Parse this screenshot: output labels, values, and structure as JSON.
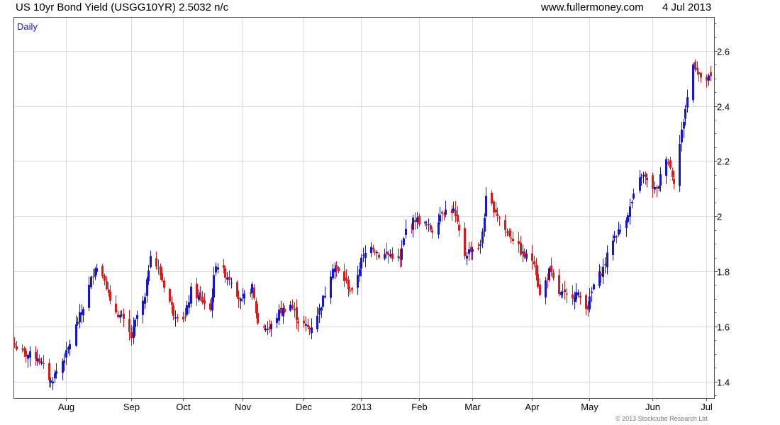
{
  "header": {
    "title": "US 10yr Bond Yield (USGG10YR) 2.5032 n/c",
    "site": "www.fullermoney.com",
    "date": "4 Jul 2013"
  },
  "footer": {
    "copyright": "© 2013 Stockcube Research Ltd"
  },
  "colors": {
    "up": "#1515d8",
    "down": "#e01818",
    "grid": "#dcdcdc",
    "axis": "#555555",
    "period_label": "#1a1ab4"
  },
  "chart_data": {
    "type": "candlestick",
    "period_label": "Daily",
    "title": "US 10yr Bond Yield (USGG10YR)",
    "last_value": 2.5032,
    "ylim": [
      1.34,
      2.72
    ],
    "y_ticks": [
      1.4,
      1.6,
      1.8,
      2.0,
      2.2,
      2.4,
      2.6
    ],
    "y_tick_labels": [
      "1.4",
      "1.6",
      "1.8",
      "2",
      "2.2",
      "2.4",
      "2.6"
    ],
    "y_axis_position": "right",
    "grid": true,
    "x_range": [
      "2012-07-05",
      "2013-07-05"
    ],
    "x_ticks": [
      {
        "date": "2012-08-01",
        "label": "Aug"
      },
      {
        "date": "2012-09-04",
        "label": "Sep"
      },
      {
        "date": "2012-10-01",
        "label": "Oct"
      },
      {
        "date": "2012-11-01",
        "label": "Nov"
      },
      {
        "date": "2012-12-03",
        "label": "Dec"
      },
      {
        "date": "2013-01-02",
        "label": "2013"
      },
      {
        "date": "2013-02-01",
        "label": "Feb"
      },
      {
        "date": "2013-03-01",
        "label": "Mar"
      },
      {
        "date": "2013-04-01",
        "label": "Apr"
      },
      {
        "date": "2013-05-01",
        "label": "May"
      },
      {
        "date": "2013-06-03",
        "label": "Jun"
      },
      {
        "date": "2013-07-01",
        "label": "Jul"
      }
    ],
    "close_anchors": [
      [
        "2012-07-05",
        1.53
      ],
      [
        "2012-07-10",
        1.5
      ],
      [
        "2012-07-17",
        1.49
      ],
      [
        "2012-07-24",
        1.4
      ],
      [
        "2012-08-01",
        1.5
      ],
      [
        "2012-08-07",
        1.62
      ],
      [
        "2012-08-10",
        1.67
      ],
      [
        "2012-08-16",
        1.82
      ],
      [
        "2012-08-21",
        1.78
      ],
      [
        "2012-08-24",
        1.68
      ],
      [
        "2012-08-30",
        1.63
      ],
      [
        "2012-09-04",
        1.56
      ],
      [
        "2012-09-07",
        1.64
      ],
      [
        "2012-09-11",
        1.7
      ],
      [
        "2012-09-14",
        1.87
      ],
      [
        "2012-09-20",
        1.77
      ],
      [
        "2012-09-26",
        1.65
      ],
      [
        "2012-10-02",
        1.63
      ],
      [
        "2012-10-05",
        1.73
      ],
      [
        "2012-10-10",
        1.7
      ],
      [
        "2012-10-15",
        1.66
      ],
      [
        "2012-10-18",
        1.83
      ],
      [
        "2012-10-23",
        1.79
      ],
      [
        "2012-10-26",
        1.77
      ],
      [
        "2012-10-31",
        1.69
      ],
      [
        "2012-11-06",
        1.74
      ],
      [
        "2012-11-09",
        1.61
      ],
      [
        "2012-11-15",
        1.59
      ],
      [
        "2012-11-20",
        1.65
      ],
      [
        "2012-11-26",
        1.68
      ],
      [
        "2012-11-30",
        1.62
      ],
      [
        "2012-12-06",
        1.59
      ],
      [
        "2012-12-11",
        1.66
      ],
      [
        "2012-12-14",
        1.72
      ],
      [
        "2012-12-18",
        1.82
      ],
      [
        "2012-12-24",
        1.77
      ],
      [
        "2012-12-28",
        1.72
      ],
      [
        "2013-01-02",
        1.84
      ],
      [
        "2013-01-07",
        1.9
      ],
      [
        "2013-01-11",
        1.86
      ],
      [
        "2013-01-17",
        1.86
      ],
      [
        "2013-01-22",
        1.84
      ],
      [
        "2013-01-25",
        1.95
      ],
      [
        "2013-01-30",
        1.99
      ],
      [
        "2013-02-04",
        1.97
      ],
      [
        "2013-02-08",
        1.95
      ],
      [
        "2013-02-13",
        2.02
      ],
      [
        "2013-02-19",
        2.02
      ],
      [
        "2013-02-25",
        1.86
      ],
      [
        "2013-02-28",
        1.88
      ],
      [
        "2013-03-05",
        1.89
      ],
      [
        "2013-03-08",
        2.06
      ],
      [
        "2013-03-13",
        2.02
      ],
      [
        "2013-03-18",
        1.95
      ],
      [
        "2013-03-22",
        1.92
      ],
      [
        "2013-03-27",
        1.86
      ],
      [
        "2013-04-02",
        1.84
      ],
      [
        "2013-04-05",
        1.71
      ],
      [
        "2013-04-10",
        1.8
      ],
      [
        "2013-04-15",
        1.72
      ],
      [
        "2013-04-19",
        1.71
      ],
      [
        "2013-04-24",
        1.72
      ],
      [
        "2013-04-30",
        1.67
      ],
      [
        "2013-05-03",
        1.75
      ],
      [
        "2013-05-08",
        1.81
      ],
      [
        "2013-05-13",
        1.92
      ],
      [
        "2013-05-17",
        1.95
      ],
      [
        "2013-05-22",
        2.03
      ],
      [
        "2013-05-28",
        2.15
      ],
      [
        "2013-05-31",
        2.13
      ],
      [
        "2013-06-05",
        2.09
      ],
      [
        "2013-06-10",
        2.22
      ],
      [
        "2013-06-14",
        2.13
      ],
      [
        "2013-06-19",
        2.35
      ],
      [
        "2013-06-24",
        2.55
      ],
      [
        "2013-06-26",
        2.54
      ],
      [
        "2013-06-28",
        2.49
      ],
      [
        "2013-07-03",
        2.5
      ]
    ]
  }
}
